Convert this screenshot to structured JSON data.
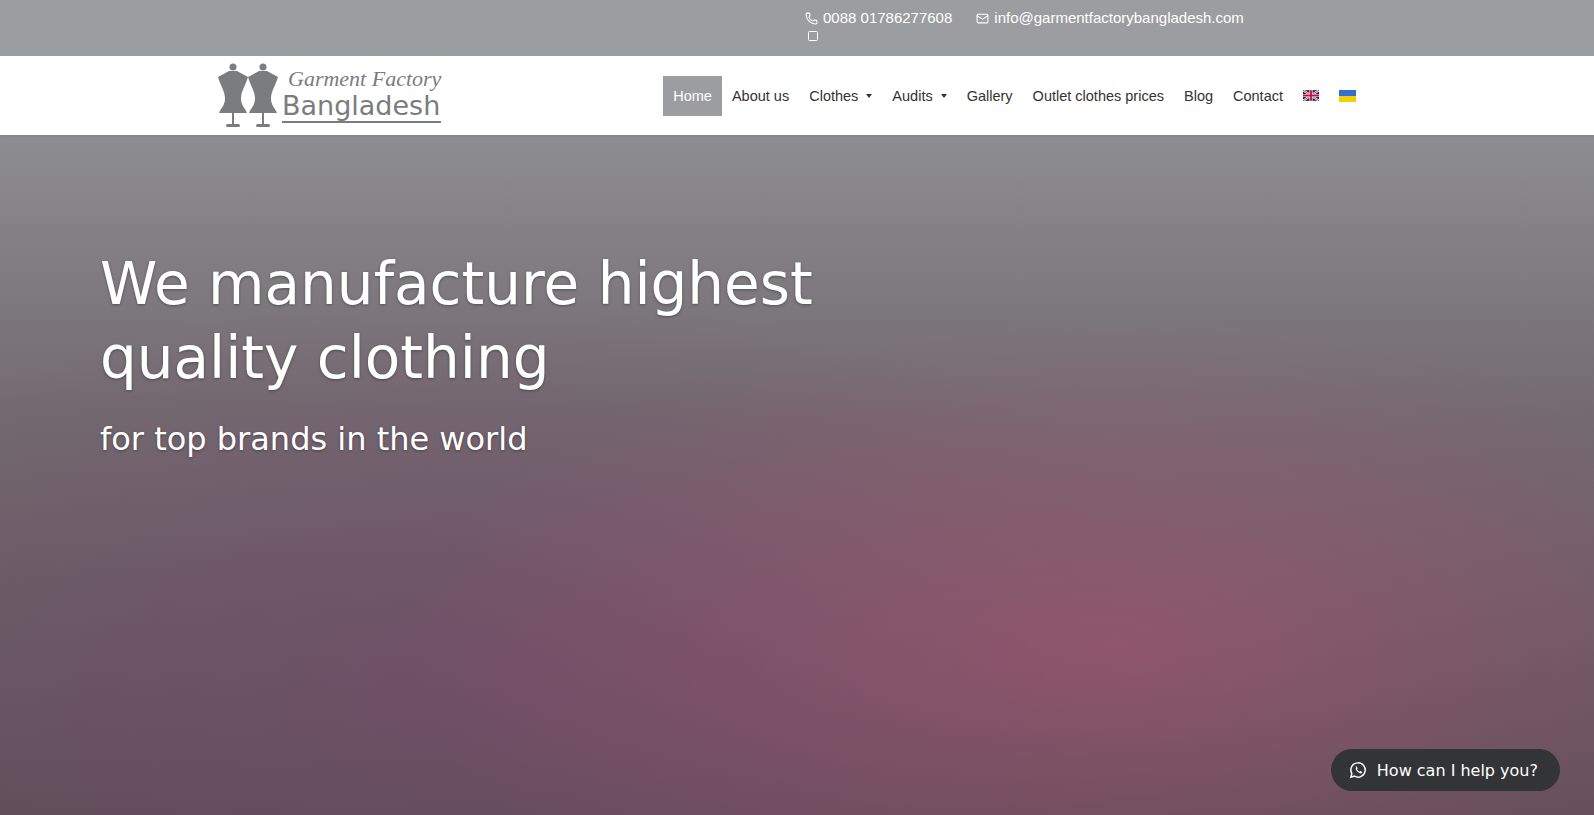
{
  "topbar": {
    "phone": "0088 01786277608",
    "email": "info@garmentfactorybangladesh.com"
  },
  "logo": {
    "line1": "Garment Factory",
    "line2": "Bangladesh"
  },
  "nav": [
    {
      "label": "Home",
      "selected": true,
      "dropdown": false
    },
    {
      "label": "About us",
      "selected": false,
      "dropdown": false
    },
    {
      "label": "Clothes",
      "selected": false,
      "dropdown": true
    },
    {
      "label": "Audits",
      "selected": false,
      "dropdown": true
    },
    {
      "label": "Gallery",
      "selected": false,
      "dropdown": false
    },
    {
      "label": "Outlet clothes prices",
      "selected": false,
      "dropdown": false
    },
    {
      "label": "Blog",
      "selected": false,
      "dropdown": false
    },
    {
      "label": "Contact",
      "selected": false,
      "dropdown": false
    }
  ],
  "hero": {
    "title": "We manufacture highest quality clothing",
    "subtitle": "for top brands in the world"
  },
  "chat": {
    "label": "How can I help you?"
  }
}
